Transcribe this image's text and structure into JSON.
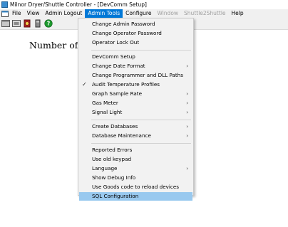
{
  "window": {
    "title": "Milnor Dryer/Shuttle Controller - [DevComm Setup]"
  },
  "menubar": {
    "items": [
      {
        "label": "File",
        "state": "normal"
      },
      {
        "label": "View",
        "state": "normal"
      },
      {
        "label": "Admin Logout",
        "state": "normal"
      },
      {
        "label": "Admin Tools",
        "state": "active"
      },
      {
        "label": "Configure",
        "state": "normal"
      },
      {
        "label": "Window",
        "state": "disabled"
      },
      {
        "label": "Shuttle2Shuttle",
        "state": "disabled"
      },
      {
        "label": "Help",
        "state": "normal"
      }
    ]
  },
  "toolbar": {
    "icons": [
      "window-icon",
      "panel-icon",
      "dryer-icon",
      "device-icon",
      "help-icon"
    ]
  },
  "content": {
    "heading": "Number of M"
  },
  "dropdown": {
    "groups": [
      [
        {
          "label": "Change Admin Password"
        },
        {
          "label": "Change Operator Password"
        },
        {
          "label": "Operator Lock Out"
        }
      ],
      [
        {
          "label": "DevComm Setup"
        },
        {
          "label": "Change Date Format",
          "submenu": true
        },
        {
          "label": "Change Programmer and DLL Paths"
        },
        {
          "label": "Audit Temperature Profiles",
          "checked": true
        },
        {
          "label": "Graph Sample Rate",
          "submenu": true
        },
        {
          "label": "Gas Meter",
          "submenu": true
        },
        {
          "label": "Signal Light",
          "submenu": true
        }
      ],
      [
        {
          "label": "Create Databases",
          "submenu": true
        },
        {
          "label": "Database Maintenance",
          "submenu": true
        }
      ],
      [
        {
          "label": "Reported Errors"
        },
        {
          "label": "Use old keypad"
        },
        {
          "label": "Language",
          "submenu": true
        },
        {
          "label": "Show Debug Info"
        },
        {
          "label": "Use Goods code to reload devices"
        },
        {
          "label": "SQL Configuration",
          "highlighted": true
        }
      ]
    ]
  },
  "colors": {
    "accent": "#0078d7",
    "highlight": "#99c9ef",
    "disabled": "#a0a0a0"
  }
}
